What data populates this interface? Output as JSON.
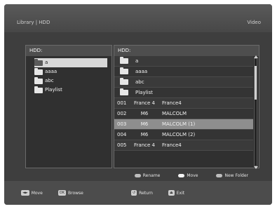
{
  "header": {
    "path": "Library | HDD",
    "mode": "Video"
  },
  "left_panel": {
    "title": "HDD:",
    "items": [
      {
        "label": "a",
        "selected": true
      },
      {
        "label": "aaaa",
        "selected": false
      },
      {
        "label": "abc",
        "selected": false
      },
      {
        "label": "Playlist",
        "selected": false
      }
    ]
  },
  "right_panel": {
    "title": "HDD:",
    "folders": [
      "a",
      "aaaa",
      "abc",
      "Playlist"
    ],
    "recordings": [
      {
        "num": "001",
        "channel": "France 4",
        "title": "France4"
      },
      {
        "num": "002",
        "channel": "M6",
        "title": "MALCOLM"
      },
      {
        "num": "003",
        "channel": "M6",
        "title": "MALCOLM (1)"
      },
      {
        "num": "004",
        "channel": "M6",
        "title": "MALCOLM (2)"
      },
      {
        "num": "005",
        "channel": "France 4",
        "title": "France4"
      }
    ]
  },
  "hints": {
    "rename": "Rename",
    "move": "Move",
    "new_folder": "New Folder"
  },
  "footer": {
    "move": "Move",
    "browse": "Browse",
    "return": "Return",
    "exit": "Exit"
  },
  "icons": [
    "folder-icon",
    "scroll-up-icon",
    "scroll-down-icon",
    "dpad-icon",
    "ok-icon",
    "return-icon",
    "exit-icon"
  ]
}
